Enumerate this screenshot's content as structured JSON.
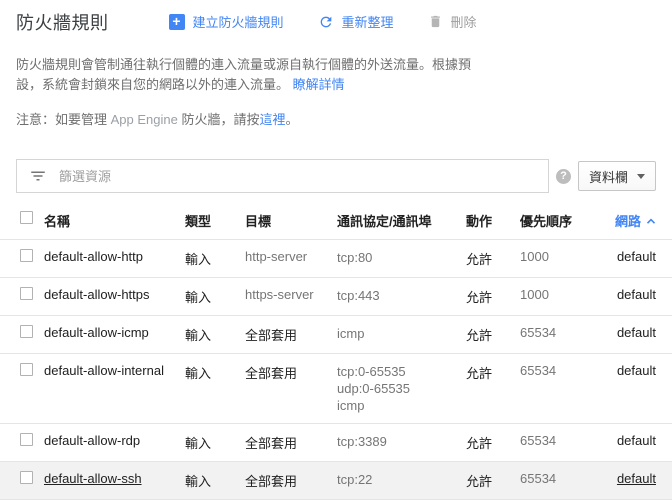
{
  "header": {
    "title": "防火牆規則",
    "create_label": "建立防火牆規則",
    "refresh_label": "重新整理",
    "delete_label": "刪除"
  },
  "description": {
    "text": "防火牆規則會管制通往執行個體的連入流量或源自執行個體的外送流量。根據預設，系統會封鎖來自您的網路以外的連入流量。",
    "learn_more": "瞭解詳情"
  },
  "note": {
    "prefix": "注意：如要管理 ",
    "app_engine": "App Engine",
    "middle": " 防火牆，請按",
    "link": "這裡",
    "suffix": "。"
  },
  "filter": {
    "placeholder": "篩選資源",
    "columns_label": "資料欄"
  },
  "icons": {
    "plus": "+",
    "help": "?"
  },
  "table": {
    "headers": [
      "名稱",
      "類型",
      "目標",
      "通訊協定/通訊埠",
      "動作",
      "優先順序",
      "網路"
    ],
    "sorted_by": "網路",
    "sort_direction": "ascending",
    "rows": [
      {
        "name": "default-allow-http",
        "type": "輸入",
        "target": "http-server",
        "target_muted": true,
        "protocols": [
          "tcp:80"
        ],
        "action": "允許",
        "priority": "1000",
        "network": "default",
        "hovered": false
      },
      {
        "name": "default-allow-https",
        "type": "輸入",
        "target": "https-server",
        "target_muted": true,
        "protocols": [
          "tcp:443"
        ],
        "action": "允許",
        "priority": "1000",
        "network": "default",
        "hovered": false
      },
      {
        "name": "default-allow-icmp",
        "type": "輸入",
        "target": "全部套用",
        "target_muted": false,
        "protocols": [
          "icmp"
        ],
        "action": "允許",
        "priority": "65534",
        "network": "default",
        "hovered": false
      },
      {
        "name": "default-allow-internal",
        "type": "輸入",
        "target": "全部套用",
        "target_muted": false,
        "protocols": [
          "tcp:0-65535",
          "udp:0-65535",
          "icmp"
        ],
        "action": "允許",
        "priority": "65534",
        "network": "default",
        "hovered": false
      },
      {
        "name": "default-allow-rdp",
        "type": "輸入",
        "target": "全部套用",
        "target_muted": false,
        "protocols": [
          "tcp:3389"
        ],
        "action": "允許",
        "priority": "65534",
        "network": "default",
        "hovered": false
      },
      {
        "name": "default-allow-ssh",
        "type": "輸入",
        "target": "全部套用",
        "target_muted": false,
        "protocols": [
          "tcp:22"
        ],
        "action": "允許",
        "priority": "65534",
        "network": "default",
        "hovered": true
      }
    ]
  },
  "colors": {
    "accent_blue": "#4285f4",
    "text_dark": "#212121",
    "text_gray": "#757575",
    "disabled_gray": "#9e9e9e",
    "row_border": "#e5e5e5",
    "hover_row_bg": "#f2f2f2"
  }
}
